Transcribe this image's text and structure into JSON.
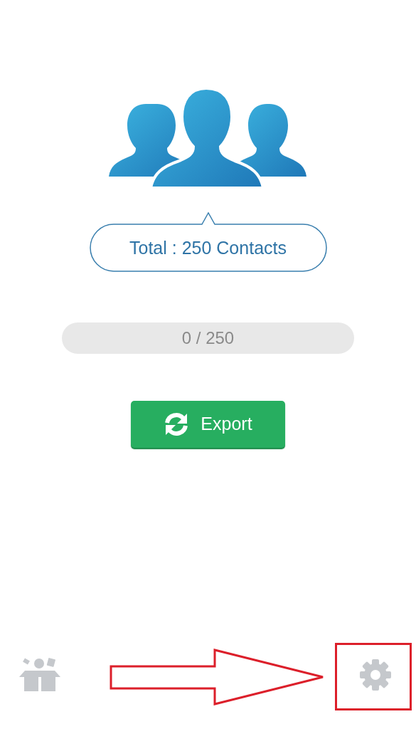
{
  "summary": {
    "text": "Total : 250 Contacts"
  },
  "progress": {
    "level": 0,
    "reading": "0 / 250"
  },
  "export_button": {
    "label": "Export"
  },
  "toolbar": [
    {
      "kind": "box"
    },
    {
      "kind": "settings",
      "highlighted": true
    }
  ]
}
